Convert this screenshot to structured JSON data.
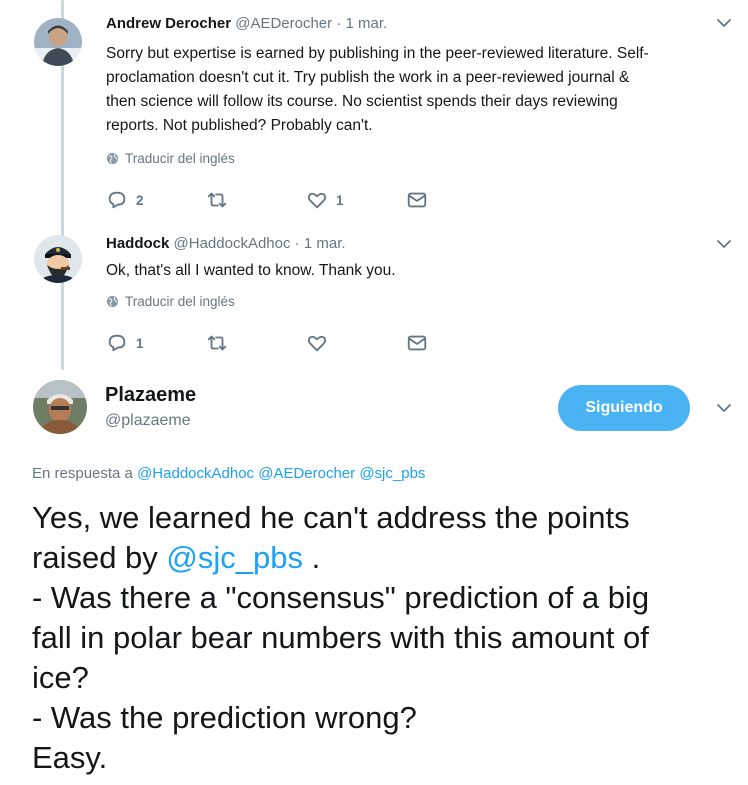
{
  "tweets": [
    {
      "name": "Andrew Derocher",
      "handle": "@AEDerocher",
      "sep": "·",
      "date": "1 mar.",
      "text_lines": [
        "Sorry but expertise is earned by publishing in the peer-reviewed literature. Self-",
        "proclamation doesn't cut it. Try publish the work in a peer-reviewed journal &",
        "then science will follow its course. No scientist spends their days reviewing",
        "reports. Not published? Probably can't."
      ],
      "translate": "Traducir del inglés",
      "reply_count": "2",
      "retweet_count": "",
      "like_count": "1"
    },
    {
      "name": "Haddock",
      "handle": "@HaddockAdhoc",
      "sep": "·",
      "date": "1 mar.",
      "text_lines": [
        "Ok, that's all I wanted to know. Thank you."
      ],
      "translate": "Traducir del inglés",
      "reply_count": "1",
      "retweet_count": "",
      "like_count": ""
    }
  ],
  "main_tweet": {
    "name": "Plazaeme",
    "handle": "@plazaeme",
    "follow_label": "Siguiendo",
    "reply_prefix": "En respuesta a",
    "reply_mentions": [
      "@HaddockAdhoc",
      "@AEDerocher",
      "@sjc_pbs"
    ],
    "line1": "Yes, we learned he can't address the points",
    "line2_pre": "raised by ",
    "line2_mention": "@sjc_pbs",
    "line2_post": " .",
    "line3": "- Was there a \"consensus\" prediction of a big",
    "line4": "fall in polar bear numbers with this amount of",
    "line5": "ice?",
    "line6": "- Was the prediction wrong?",
    "line7": "Easy."
  },
  "colors": {
    "accent": "#1da1f2",
    "follow_button": "#4ab3f4",
    "muted": "#657786",
    "thread_line": "#ccd6dd"
  },
  "icons": [
    "reply-icon",
    "retweet-icon",
    "like-icon",
    "message-icon",
    "globe-icon",
    "chevron-down-icon"
  ]
}
